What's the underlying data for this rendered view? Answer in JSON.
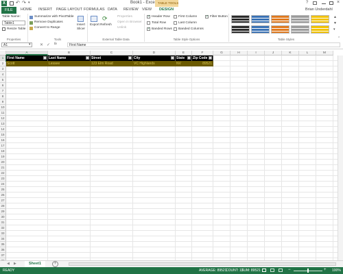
{
  "window": {
    "title": "Book1 - Excel",
    "contextual_tab": "TABLE TOOLS",
    "user": "Brian Underdahl",
    "help": "?"
  },
  "tabs": [
    "FILE",
    "HOME",
    "INSERT",
    "PAGE LAYOUT",
    "FORMULAS",
    "DATA",
    "REVIEW",
    "VIEW",
    "DESIGN"
  ],
  "ribbon": {
    "properties": {
      "label": "Properties",
      "table_name_label": "Table Name:",
      "table_name_value": "Table1",
      "resize": "Resize Table"
    },
    "tools": {
      "label": "Tools",
      "summarize": "Summarize with PivotTable",
      "remove_duplicates": "Remove Duplicates",
      "convert": "Convert to Range",
      "insert_slicer_1": "Insert",
      "insert_slicer_2": "Slicer"
    },
    "external": {
      "label": "External Table Data",
      "export": "Export",
      "refresh": "Refresh",
      "properties": "Properties",
      "open_browser": "Open in Browser",
      "unlink": "Unlink"
    },
    "style_options": {
      "label": "Table Style Options",
      "header_row": "Header Row",
      "total_row": "Total Row",
      "banded_rows": "Banded Rows",
      "first_column": "First Column",
      "last_column": "Last Column",
      "banded_columns": "Banded Columns",
      "filter_button": "Filter Button"
    },
    "table_styles": {
      "label": "Table Styles",
      "swatches": [
        "#2b2b2b",
        "#3a72b5",
        "#e07a1f",
        "#9b9b9b",
        "#f2c200",
        "#2b2b2b",
        "#3a72b5",
        "#e07a1f",
        "#9b9b9b",
        "#f2c200"
      ]
    }
  },
  "formula_bar": {
    "name_box": "A1",
    "fx": "fx",
    "content": "First Name"
  },
  "columns": [
    "A",
    "B",
    "C",
    "D",
    "E",
    "F",
    "G",
    "H",
    "I",
    "J",
    "K",
    "L",
    "M"
  ],
  "rows": [
    "1",
    "2",
    "3",
    "4",
    "5",
    "6",
    "7",
    "8",
    "9",
    "10",
    "11",
    "12",
    "13",
    "14",
    "15",
    "16",
    "17",
    "18",
    "19",
    "20",
    "21",
    "22",
    "23",
    "24",
    "25",
    "26",
    "27",
    "28",
    "29",
    "30",
    "31",
    "32",
    "33",
    "34",
    "35",
    "36",
    "37",
    "38"
  ],
  "table": {
    "headers": [
      "First Name",
      "Last Name",
      "Street",
      "City",
      "State",
      "Zip Code"
    ],
    "row": [
      "Scott",
      "Lessee",
      "123 Elm Road",
      "VC Highlands",
      "NV",
      "89521"
    ]
  },
  "sheet_tabs": [
    "Sheet1"
  ],
  "status": {
    "ready": "READY",
    "average": "AVERAGE: 89521",
    "count": "COUNT: 12",
    "sum": "SUM: 89521",
    "zoom": "100%"
  },
  "colors": {
    "accent": "#217346",
    "header_fill": "#000000",
    "row_fill": "#6b5a00",
    "row_text": "#d8c65a"
  }
}
